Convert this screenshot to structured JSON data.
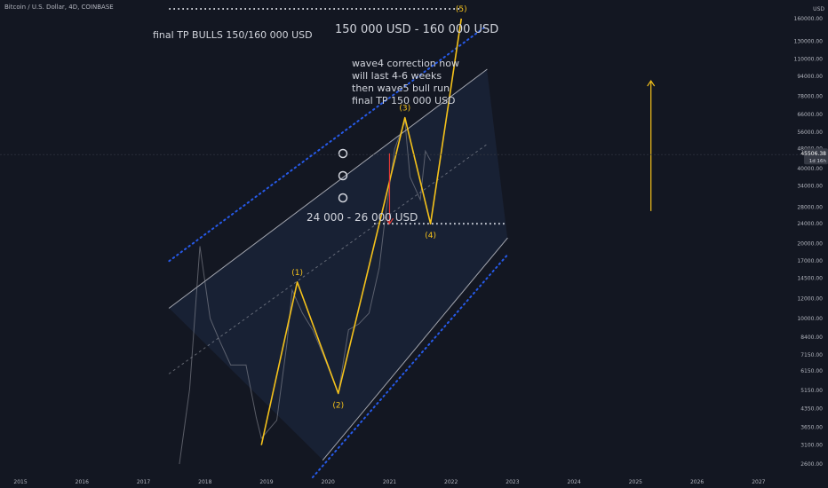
{
  "header": {
    "symbol": "Bitcoin / U.S. Dollar, 4D, COINBASE"
  },
  "colors": {
    "background": "#131722",
    "wave": "#f5c21b",
    "channel_dots": "#2962ff",
    "channel_lines": "#b2b5be",
    "arrow_up": "#f5c21b",
    "arrow_down": "#e53935",
    "text": "#d1d4dc"
  },
  "price_axis": {
    "unit_label": "USD",
    "last_price": "45506.38",
    "countdown": "1d 16h",
    "ticks": [
      "160000.00",
      "130000.00",
      "110000.00",
      "94000.00",
      "78000.00",
      "66000.00",
      "56000.00",
      "48000.00",
      "40000.00",
      "34000.00",
      "28000.00",
      "24000.00",
      "20000.00",
      "17000.00",
      "14500.00",
      "12000.00",
      "10000.00",
      "8400.00",
      "7150.00",
      "6150.00",
      "5150.00",
      "4350.00",
      "3650.00",
      "3100.00",
      "2600.00"
    ]
  },
  "time_axis": {
    "ticks": [
      "2015",
      "2016",
      "2017",
      "2018",
      "2019",
      "2020",
      "2021",
      "2022",
      "2023",
      "2024",
      "2025",
      "2026",
      "2027"
    ]
  },
  "annotations": {
    "final_tp": "final TP BULLS 150/160 000 USD",
    "target_range": "150 000 USD - 160 000 USD",
    "support_range": "24 000 - 26 000 USD",
    "note": [
      "wave4 correction now",
      "will last 4-6 weeks",
      "then wave5 bull run",
      "final TP 150 000 USD"
    ]
  },
  "chart_data": {
    "type": "line",
    "title": "",
    "xlabel": "",
    "ylabel": "",
    "y_scale": "log",
    "xlim": [
      "2014-09",
      "2027-09"
    ],
    "ylim": [
      2300,
      190000
    ],
    "grid": false,
    "price_series": {
      "name": "",
      "x": [
        "2017-08",
        "2017-10",
        "2017-12",
        "2018-02",
        "2018-04",
        "2018-06",
        "2018-09",
        "2018-11",
        "2018-12",
        "2019-03",
        "2019-05",
        "2019-06",
        "2019-08",
        "2019-10",
        "2019-12",
        "2020-03",
        "2020-05",
        "2020-07",
        "2020-09",
        "2020-11",
        "2020-12",
        "2021-01",
        "2021-02",
        "2021-04",
        "2021-05",
        "2021-07",
        "2021-08",
        "2021-09"
      ],
      "y": [
        2600,
        5200,
        19500,
        10000,
        8000,
        6500,
        6500,
        4000,
        3300,
        3900,
        8000,
        13000,
        10500,
        9000,
        7200,
        5000,
        9000,
        9500,
        10500,
        16000,
        24000,
        34000,
        48000,
        62000,
        37000,
        30000,
        47000,
        43000
      ]
    },
    "wave_count": {
      "labels": [
        "(1)",
        "(2)",
        "(3)",
        "(4)",
        "(5)"
      ],
      "x": [
        "2018-12",
        "2019-07",
        "2020-03",
        "2021-04",
        "2021-09",
        "2022-03"
      ],
      "y": [
        3100,
        14000,
        5000,
        64000,
        24000,
        160000
      ]
    },
    "horizontal_levels": [
      {
        "label": "final TP BULLS 150/160 000 USD",
        "y": 175000,
        "x_from": "2017-06",
        "x_to": "2022-03"
      },
      {
        "label": "24 000 - 26 000 USD",
        "y": 24000,
        "x_from": "2020-10",
        "x_to": "2022-12"
      }
    ],
    "channel": {
      "outer_upper": [
        [
          "2017-06",
          17000
        ],
        [
          "2022-08",
          150000
        ]
      ],
      "outer_lower": [
        [
          "2019-10",
          2300
        ],
        [
          "2022-12",
          18000
        ]
      ],
      "inner_upper": [
        [
          "2017-06",
          11000
        ],
        [
          "2022-08",
          100000
        ]
      ],
      "inner_lower": [
        [
          "2019-12",
          2700
        ],
        [
          "2022-12",
          21000
        ]
      ],
      "median": [
        [
          "2017-06",
          6000
        ],
        [
          "2022-08",
          50000
        ]
      ]
    },
    "arrows": [
      {
        "direction": "down",
        "x": "2021-01",
        "from": 46000,
        "to": 24000
      },
      {
        "direction": "up",
        "x": "2025-04",
        "from": 27000,
        "to": 90000
      }
    ]
  }
}
